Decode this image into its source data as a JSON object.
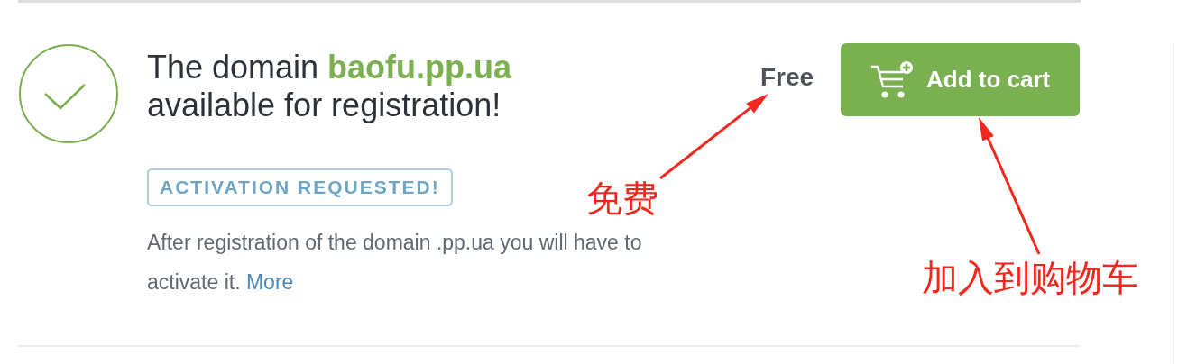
{
  "result": {
    "available": true,
    "heading_before": "The domain",
    "domain": "baofu.pp.ua",
    "heading_after": "available for registration!"
  },
  "badge": "ACTIVATION REQUESTED!",
  "note": {
    "text": "After registration of the domain .pp.ua you will have to activate it.",
    "link": "More"
  },
  "price": "Free",
  "button": "Add to cart",
  "annotations": [
    {
      "text": "免费",
      "kind": "price"
    },
    {
      "text": "加入到购物车",
      "kind": "button"
    }
  ]
}
